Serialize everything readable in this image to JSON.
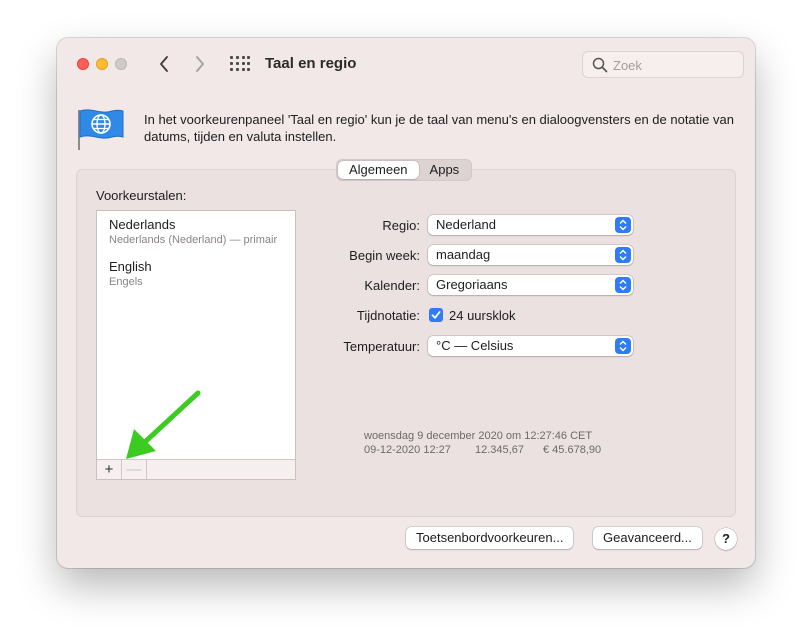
{
  "window": {
    "title": "Taal en regio",
    "search_placeholder": "Zoek"
  },
  "icons": {
    "back": "chevron-left-icon",
    "forward": "chevron-right-icon",
    "show_all": "grid-icon",
    "search": "search-icon",
    "pane": "globe-flag-icon"
  },
  "intro": "In het voorkeurenpaneel 'Taal en regio' kun je de taal van menu's en dialoogvensters en de notatie van datums, tijden en valuta instellen.",
  "tabs": [
    {
      "label": "Algemeen",
      "active": true
    },
    {
      "label": "Apps",
      "active": false
    }
  ],
  "languages": {
    "heading": "Voorkeurstalen:",
    "items": [
      {
        "name": "Nederlands",
        "sub": "Nederlands (Nederland) — primair"
      },
      {
        "name": "English",
        "sub": "Engels"
      }
    ],
    "add_label": "+",
    "remove_label": "—"
  },
  "form": {
    "region_label": "Regio:",
    "region_value": "Nederland",
    "week_label": "Begin week:",
    "week_value": "maandag",
    "calendar_label": "Kalender:",
    "calendar_value": "Gregoriaans",
    "time_label": "Tijdnotatie:",
    "time_checkbox_label": "24 uursklok",
    "time_checkbox_checked": true,
    "temp_label": "Temperatuur:",
    "temp_value": "°C — Celsius"
  },
  "sample": {
    "line1": "woensdag 9 december 2020 om 12:27:46 CET",
    "date_short": "09-12-2020 12:27",
    "number": "12.345,67",
    "currency": "€ 45.678,90"
  },
  "buttons": {
    "keyboard": "Toetsenbordvoorkeuren...",
    "advanced": "Geavanceerd...",
    "help": "?"
  },
  "colors": {
    "accent": "#2f7cf6",
    "window_bg": "#f1e8e7",
    "annotation_arrow": "#3ccb21"
  }
}
